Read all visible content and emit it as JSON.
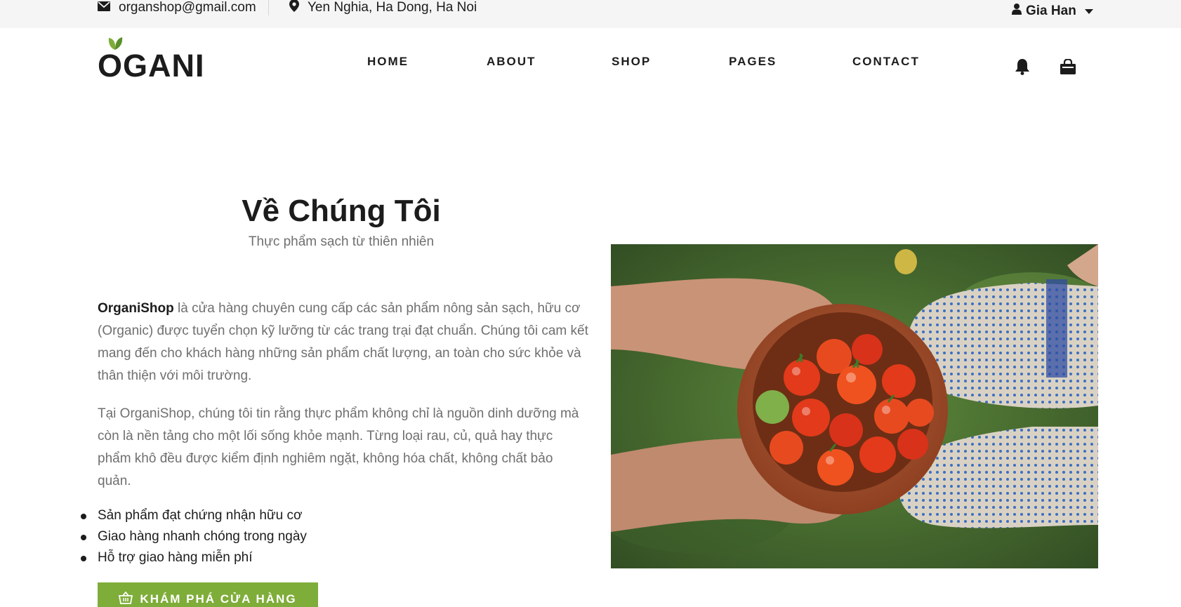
{
  "topbar": {
    "email": "organshop@gmail.com",
    "address": "Yen Nghia, Ha Dong, Ha Noi",
    "user_name": "Gia Han",
    "icons": {
      "email": "envelope-icon",
      "address": "map-pin-icon",
      "user": "user-icon"
    }
  },
  "header": {
    "logo_text": "OGANI",
    "nav": {
      "home": "HOME",
      "about": "ABOUT",
      "shop": "SHOP",
      "pages": "PAGES",
      "contact": "CONTACT"
    },
    "icons": {
      "notifications": "bell-icon",
      "cart": "shopping-bag-icon"
    }
  },
  "about": {
    "title": "Về Chúng Tôi",
    "subtitle": "Thực phẩm sạch từ thiên nhiên",
    "brand": "OrganiShop",
    "paragraph1_rest": " là cửa hàng chuyên cung cấp các sản phẩm nông sản sạch, hữu cơ (Organic) được tuyển chọn kỹ lưỡng từ các trang trại đạt chuẩn. Chúng tôi cam kết mang đến cho khách hàng những sản phẩm chất lượng, an toàn cho sức khỏe và thân thiện với môi trường.",
    "paragraph2": "Tại OrganiShop, chúng tôi tin rằng thực phẩm không chỉ là nguồn dinh dưỡng mà còn là nền tảng cho một lối sống khỏe mạnh. Từng loại rau, củ, quả hay thực phẩm khô đều được kiểm định nghiêm ngặt, không hóa chất, không chất bảo quản.",
    "bullets": [
      "Sản phẩm đạt chứng nhận hữu cơ",
      "Giao hàng nhanh chóng trong ngày",
      "Hỗ trợ giao hàng miễn phí"
    ],
    "cta_label": "KHÁM PHÁ CỬA HÀNG",
    "cta_icon": "basket-icon"
  },
  "colors": {
    "accent": "#7fad39",
    "text": "#1c1c1c",
    "muted": "#6f6f6f",
    "topbar_bg": "#f5f5f5"
  }
}
